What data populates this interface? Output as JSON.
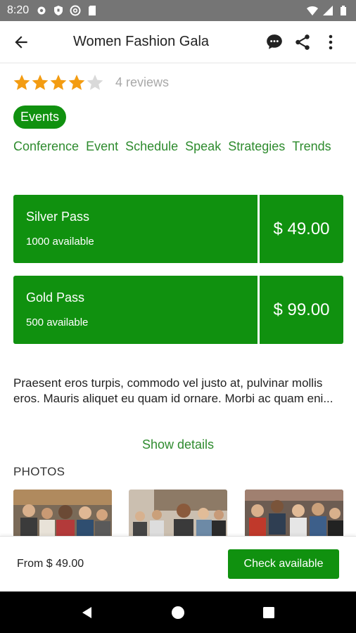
{
  "status_bar": {
    "time": "8:20"
  },
  "app_bar": {
    "title": "Women Fashion Gala"
  },
  "rating": {
    "stars_filled": 4,
    "stars_total": 5,
    "reviews_label": "4 reviews"
  },
  "category": "Events",
  "tags": [
    "Conference",
    "Event",
    "Schedule",
    "Speak",
    "Strategies",
    "Trends"
  ],
  "passes": [
    {
      "name": "Silver Pass",
      "availability": "1000 available",
      "price": "$ 49.00"
    },
    {
      "name": "Gold Pass",
      "availability": "500 available",
      "price": "$ 99.00"
    }
  ],
  "description": "Praesent eros turpis, commodo vel justo at, pulvinar mollis eros. Mauris aliquet eu quam id ornare. Morbi ac quam eni...",
  "show_details_label": "Show details",
  "photos_label": "PHOTOS",
  "bottom_bar": {
    "price_from": "From $ 49.00",
    "cta_label": "Check available"
  },
  "colors": {
    "accent": "#10910f",
    "tag_text": "#2e8b2e",
    "star": "#f39c12",
    "star_empty": "#d9d9d9"
  }
}
